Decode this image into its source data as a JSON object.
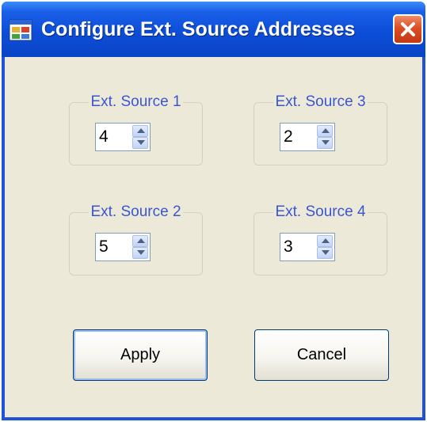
{
  "window": {
    "title": "Configure Ext. Source Addresses",
    "title_icon": "app-window-icon",
    "close_icon": "close-icon"
  },
  "sources": [
    {
      "label": "Ext. Source 1",
      "value": "4"
    },
    {
      "label": "Ext. Source 2",
      "value": "5"
    },
    {
      "label": "Ext. Source 3",
      "value": "2"
    },
    {
      "label": "Ext. Source 4",
      "value": "3"
    }
  ],
  "buttons": {
    "apply_label": "Apply",
    "cancel_label": "Cancel"
  },
  "colors": {
    "titlebar": "#0a44c6",
    "dialog_background": "#ece9d8",
    "group_label": "#3a56d0",
    "close_button": "#dc4d24"
  }
}
